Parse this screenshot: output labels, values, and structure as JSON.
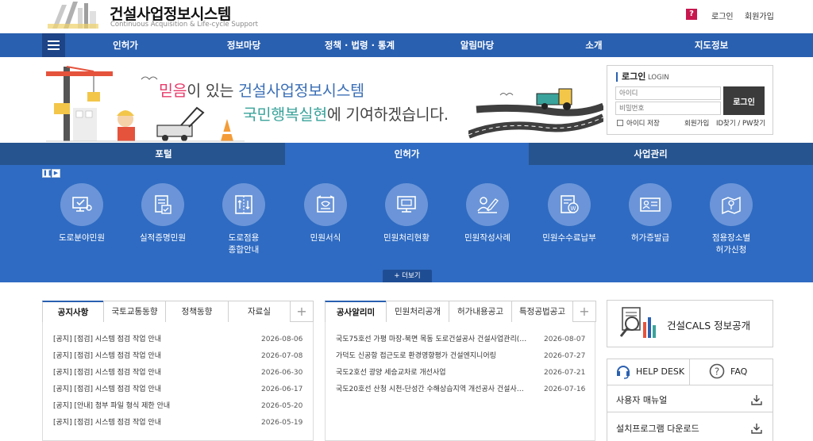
{
  "header": {
    "logo_title": "건설사업정보시스템",
    "logo_subtitle": "Continuous Acquisition & Life-cycle Support",
    "help_icon": "?",
    "login_link": "로그인",
    "join_link": "회원가입"
  },
  "nav": {
    "items": [
      "인허가",
      "정보마당",
      "정책 · 법령 · 통계",
      "알림마당",
      "소개",
      "지도정보"
    ]
  },
  "banner": {
    "slogan1_a": "믿음",
    "slogan1_b": "이 있는 ",
    "slogan1_c": "건설사업정보시스템",
    "slogan2_a": "국민행복실현",
    "slogan2_b": "에 기여하겠습니다."
  },
  "login": {
    "title": "로그인",
    "title_en": "LOGIN",
    "id_placeholder": "아이디",
    "pw_placeholder": "비밀번호",
    "button": "로그인",
    "save_id": "아이디 저장",
    "join": "회원가입",
    "find": "ID찾기 / PW찾기"
  },
  "section_tabs": [
    "포털",
    "인허가",
    "사업관리"
  ],
  "services": {
    "items": [
      {
        "label": "도로분야민원",
        "icon": "monitor-check-icon"
      },
      {
        "label": "실적증명민원",
        "icon": "document-check-icon"
      },
      {
        "label": "도로점용\n종합안내",
        "icon": "road-guide-icon"
      },
      {
        "label": "민원서식",
        "icon": "map-form-icon"
      },
      {
        "label": "민원처리현황",
        "icon": "monitor-status-icon"
      },
      {
        "label": "민원작성사례",
        "icon": "person-write-icon"
      },
      {
        "label": "민원수수료납부",
        "icon": "fee-payment-icon"
      },
      {
        "label": "허가증발급",
        "icon": "id-card-icon"
      },
      {
        "label": "점용장소별\n허가신청",
        "icon": "location-map-icon"
      }
    ],
    "more": "+ 더보기"
  },
  "notice_box": {
    "tabs": [
      "공지사항",
      "국토교통동향",
      "정책동향",
      "자료실"
    ],
    "rows": [
      {
        "title": "[공지] [점검] 시스템 점검 작업 안내",
        "date": "2026-08-06"
      },
      {
        "title": "[공지] [점검] 시스템 점검 작업 안내",
        "date": "2026-07-08"
      },
      {
        "title": "[공지] [점검] 시스템 점검 작업 안내",
        "date": "2026-06-30"
      },
      {
        "title": "[공지] [점검] 시스템 점검 작업 안내",
        "date": "2026-06-17"
      },
      {
        "title": "[공지] [안내] 첨부 파일 형식 제한 안내",
        "date": "2026-05-20"
      },
      {
        "title": "[공지] [점검] 시스템 점검 작업 안내",
        "date": "2026-05-19"
      }
    ]
  },
  "project_box": {
    "tabs": [
      "공사알리미",
      "민원처리공개",
      "허가내용공고",
      "특정공법공고"
    ],
    "rows": [
      {
        "title": "국도75호선 가평 마장-북면 목동 도로건설공사 건설사업관리(…",
        "date": "2026-08-07"
      },
      {
        "title": "가덕도 신공항 접근도로 환경영향평가 건설엔지니어링",
        "date": "2026-07-27"
      },
      {
        "title": "국도2호선 광양 세승교차로 개선사업",
        "date": "2026-07-21"
      },
      {
        "title": "국도20호선 산청 시천-단성간 수해상습지역 개선공사 건설사…",
        "date": "2026-07-16"
      }
    ]
  },
  "side": {
    "cals_label": "건설CALS 정보공개",
    "helpdesk": "HELP DESK",
    "faq": "FAQ",
    "manual": "사용자 매뉴얼",
    "installer": "설치프로그램 다운로드"
  },
  "colors": {
    "nav_blue": "#2a60b0",
    "panel_blue": "#2f6bc2",
    "tab_dark": "#26548f",
    "accent_pink": "#e83a6a"
  }
}
